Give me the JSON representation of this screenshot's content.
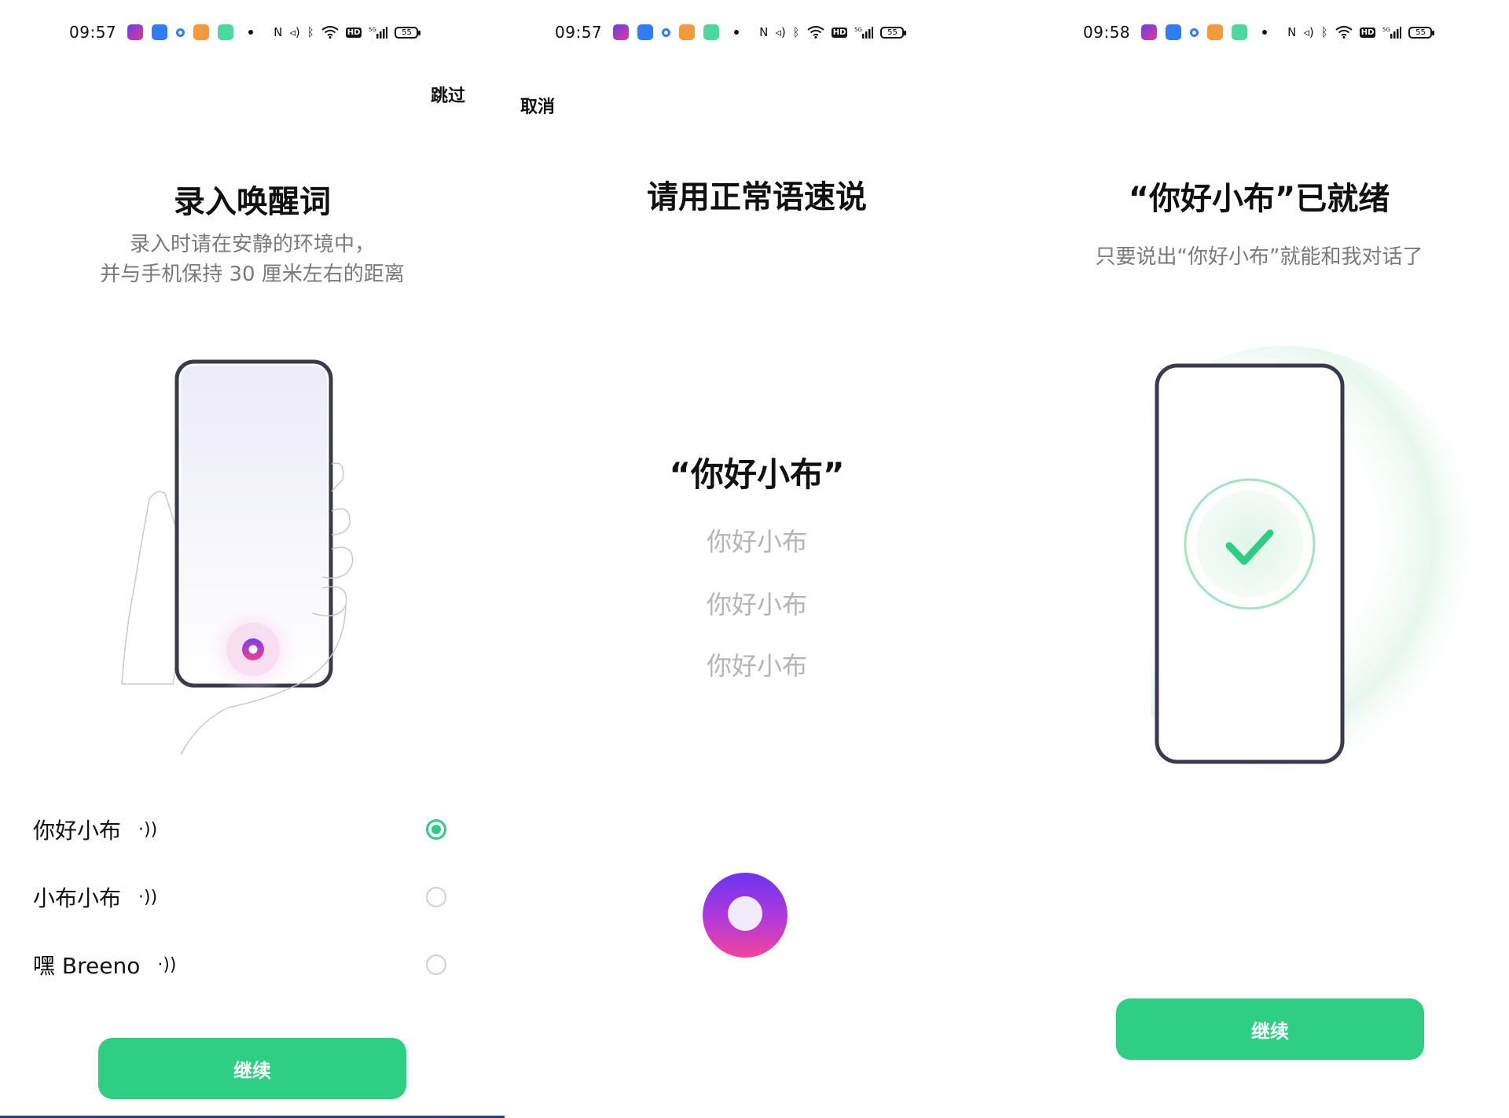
{
  "panels": [
    {
      "status": {
        "time": "09:57",
        "battery": "55"
      },
      "skip_label": "跳过",
      "title": "录入唤醒词",
      "subtitle_line1": "录入时请在安静的环境中，",
      "subtitle_line2": "并与手机保持 30 厘米左右的距离",
      "options": [
        {
          "label": "你好小布",
          "selected": true
        },
        {
          "label": "小布小布",
          "selected": false
        },
        {
          "label": "嘿 Breeno",
          "selected": false
        }
      ],
      "continue_label": "继续"
    },
    {
      "status": {
        "time": "09:57",
        "battery": "55"
      },
      "cancel_label": "取消",
      "title": "请用正常语速说",
      "phrase": "“你好小布”",
      "repeats": [
        "你好小布",
        "你好小布",
        "你好小布"
      ]
    },
    {
      "status": {
        "time": "09:58",
        "battery": "55"
      },
      "title": "“你好小布”已就绪",
      "subtitle": "只要说出“你好小布”就能和我对话了",
      "continue_label": "继续"
    }
  ],
  "colors": {
    "accent_green": "#2ecf84",
    "breeno_purple": "#7b3cf0",
    "breeno_pink": "#f0408a"
  },
  "icons": [
    "nfc-icon",
    "vibrate-icon",
    "bluetooth-icon",
    "wifi-icon",
    "hd-icon",
    "signal-5g-icon",
    "battery-icon",
    "speaker-wave-icon"
  ]
}
